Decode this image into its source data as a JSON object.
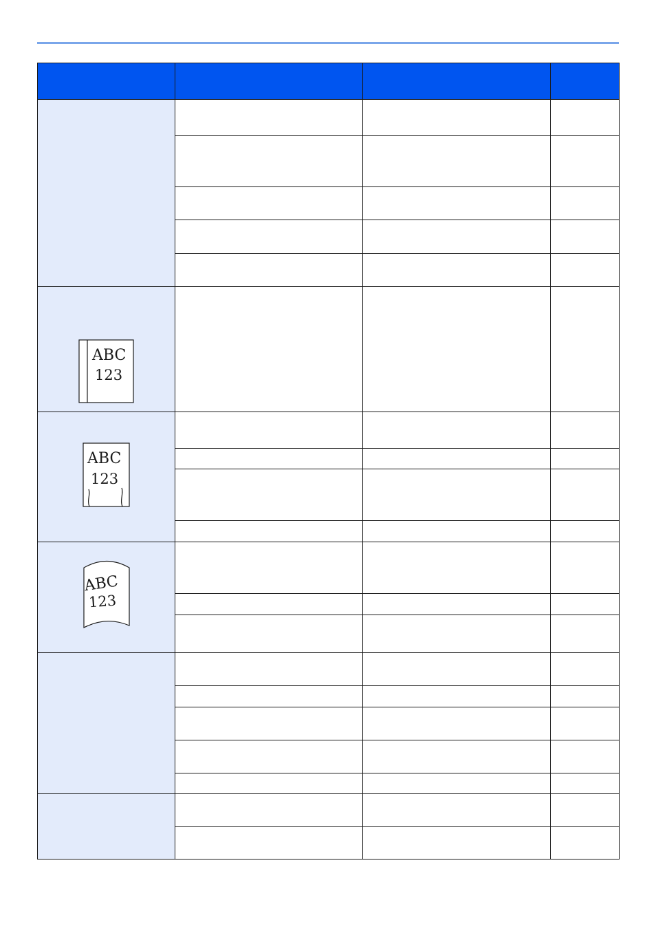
{
  "table": {
    "headers": [
      "",
      "",
      "",
      ""
    ],
    "illustrations": [
      {
        "name": "paper-edge-line-illustration",
        "line1": "ABC",
        "line2": "123"
      },
      {
        "name": "wavy-edge-paper-illustration",
        "line1": "ABC",
        "line2": "123"
      },
      {
        "name": "curled-paper-illustration",
        "line1": "ABC",
        "line2": "123"
      }
    ]
  }
}
